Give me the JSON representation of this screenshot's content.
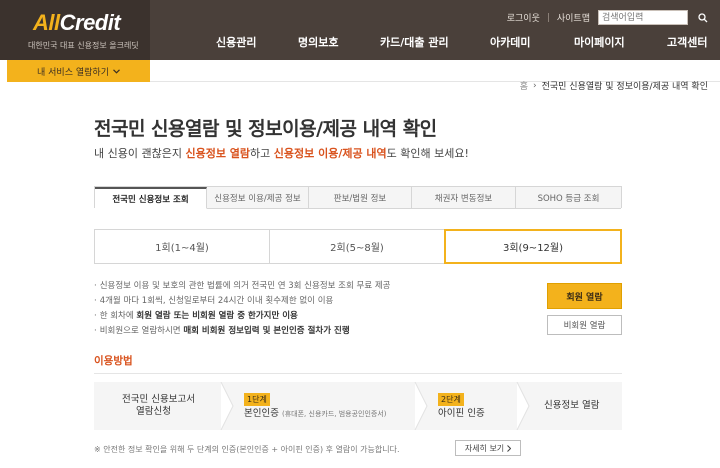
{
  "logo": {
    "text_all": "All",
    "text_credit": "Credit",
    "sub": "대한민국 대표 신용정보 올크레딧"
  },
  "util": {
    "login": "로그이웃",
    "sitemap": "사이트맵",
    "search_placeholder": "검색어입력"
  },
  "gnb": [
    "신용관리",
    "명의보호",
    "카드/대출 관리",
    "아카데미",
    "마이페이지",
    "고객센터"
  ],
  "service_button": "내 서비스 열람하기",
  "breadcrumb": {
    "home": "홈",
    "sep": "›",
    "current": "전국민 신용열람 및 정보이용/제공 내역 확인"
  },
  "page_title": "전국민 신용열람 및 정보이용/제공 내역 확인",
  "subtitle": {
    "p1": "내 신용이 괜찮은지 ",
    "h1": "신용정보 열람",
    "p2": "하고 ",
    "h2": "신용정보 이용/제공 내역",
    "p3": "도 확인해 보세요!"
  },
  "tabs": [
    "전국민 신용정보 조회",
    "신용정보 이용/제공 정보",
    "판보/법원 정보",
    "채권자 변동정보",
    "SOHO 등급 조회"
  ],
  "periods": [
    "1회(1~4월)",
    "2회(5~8월)",
    "3회(9~12월)"
  ],
  "info": {
    "l1": "신용정보 이용 및 보호의 관한 법률에 의거 전국민 연 3회 신용정보 조회 무료 제공",
    "l2": "4개월 마다 1회씩, 신청일로부터 24시간 이내 횟수제한 없이 이용",
    "l3a": "한 회차에 ",
    "l3b": "회원 열람 또는 비회원 열람 중 한가지만 이용",
    "l4a": "비회원으로 열람하시면 ",
    "l4b": "매회 비회원 정보입력 및 본인인증 절차가 진행"
  },
  "buttons": {
    "member": "회원 열람",
    "nonmember": "비회원 열람",
    "more": "자세히 보기"
  },
  "section_label": "이용방법",
  "steps": {
    "s1a": "전국민 신용보고서",
    "s1b": "열람신청",
    "s2_badge": "1단계",
    "s2": "본인인증",
    "s2_small": "(휴대폰, 신용카드, 범용공인인증서)",
    "s3_badge": "2단계",
    "s3": "아이핀 인증",
    "s4": "신용정보 열람"
  },
  "note": "※ 안전한 정보 확인을 위해 두 단계의 인증(본인인증 + 아이핀 인증) 후 열람이 가능합니다."
}
